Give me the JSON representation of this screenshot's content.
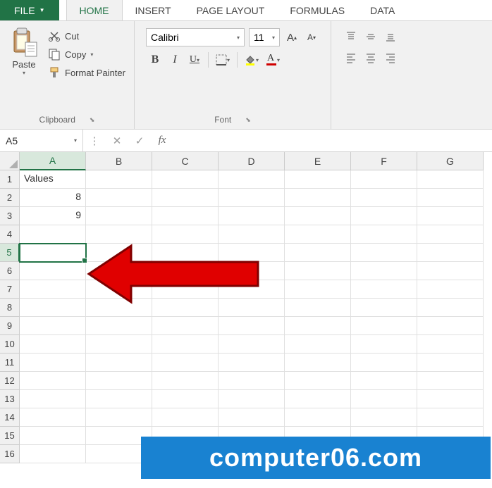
{
  "tabs": {
    "file": "FILE",
    "home": "HOME",
    "insert": "INSERT",
    "page_layout": "PAGE LAYOUT",
    "formulas": "FORMULAS",
    "data": "DATA"
  },
  "ribbon": {
    "clipboard": {
      "paste": "Paste",
      "cut": "Cut",
      "copy": "Copy",
      "format_painter": "Format Painter",
      "label": "Clipboard"
    },
    "font": {
      "name": "Calibri",
      "size": "11",
      "label": "Font"
    }
  },
  "formula_bar": {
    "namebox": "A5",
    "fx": "fx",
    "formula": ""
  },
  "grid": {
    "columns": [
      "A",
      "B",
      "C",
      "D",
      "E",
      "F",
      "G"
    ],
    "rows": [
      "1",
      "2",
      "3",
      "4",
      "5",
      "6",
      "7",
      "8",
      "9",
      "10",
      "11",
      "12",
      "13",
      "14",
      "15",
      "16"
    ],
    "selected_row": "5",
    "selected_col": "A",
    "data": {
      "A1": "Values",
      "A2": "8",
      "A3": "9"
    }
  },
  "watermark": "computer06.com"
}
